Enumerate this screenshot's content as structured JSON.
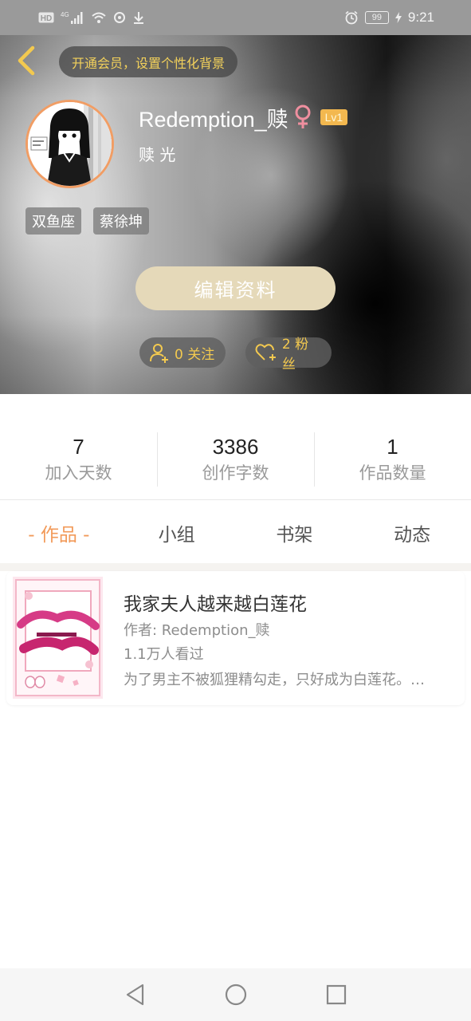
{
  "status_bar": {
    "network_label": "HD",
    "signal_label": "4G",
    "battery": "99",
    "time": "9:21",
    "icons": [
      "hd-icon",
      "signal-icon",
      "wifi-icon",
      "sync-icon",
      "download-icon",
      "alarm-icon",
      "battery-icon",
      "charging-icon"
    ]
  },
  "header": {
    "back_icon": "chevron-left-icon",
    "vip_banner": "开通会员，设置个性化背景",
    "username": "Redemption_赎",
    "gender_icon": "female-icon",
    "level": "Lv1",
    "nickname": "赎 光",
    "tags": [
      "双鱼座",
      "蔡徐坤"
    ],
    "edit_button": "编辑资料",
    "follow": {
      "icon": "add-user-icon",
      "label": "0 关注"
    },
    "fans": {
      "icon": "heart-plus-icon",
      "label": "2 粉丝"
    },
    "colors": {
      "accent_gold": "#f3c94f",
      "avatar_border": "#f19d64",
      "edit_button_bg": "#e5d9b9"
    }
  },
  "stats": [
    {
      "value": "7",
      "label": "加入天数"
    },
    {
      "value": "3386",
      "label": "创作字数"
    },
    {
      "value": "1",
      "label": "作品数量"
    }
  ],
  "tabs": [
    {
      "label": "- 作品 -",
      "active": true
    },
    {
      "label": "小组",
      "active": false
    },
    {
      "label": "书架",
      "active": false
    },
    {
      "label": "动态",
      "active": false
    }
  ],
  "books": [
    {
      "title": "我家夫人越来越白莲花",
      "author": "作者: Redemption_赎",
      "views": "1.1万人看过",
      "description": "为了男主不被狐狸精勾走，只好成为白莲花。…"
    }
  ],
  "nav_bar": {
    "icons": [
      "back-triangle-icon",
      "home-circle-icon",
      "recents-square-icon"
    ]
  },
  "theme": {
    "active_tab_color": "#f29a59"
  }
}
